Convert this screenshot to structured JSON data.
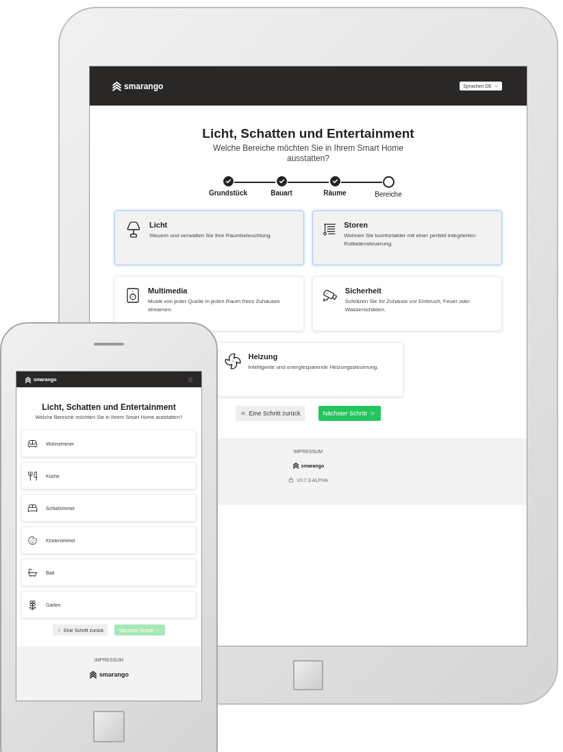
{
  "tablet": {
    "header": {
      "logo": "smarango",
      "language_select": "Sprachen DE"
    },
    "title": "Licht, Schatten und Entertainment",
    "subtitle": "Welche Bereiche möchten Sie in Ihrem Smart Home ausstatten?",
    "steps": [
      {
        "label": "Grundstück",
        "done": true
      },
      {
        "label": "Bauart",
        "done": true
      },
      {
        "label": "Räume",
        "done": true
      },
      {
        "label": "Bereiche",
        "done": false
      }
    ],
    "cards": [
      {
        "kind": "lamp",
        "title": "Licht",
        "text": "Steuern und verwalten Sie ihre Raumbeleuchtung.",
        "selected": true
      },
      {
        "kind": "blinds",
        "title": "Storen",
        "text": "Wohnen Sie komfortabler mit einer perfekt integrierten Rollladensteuerung.",
        "selected": true
      },
      {
        "kind": "speaker",
        "title": "Multimedia",
        "text": "Musik von jeder Quelle in jeden Raum Ihres Zuhauses streamen.",
        "selected": false
      },
      {
        "kind": "camera",
        "title": "Sicherheit",
        "text": "Schützen Sie ihr Zuhause vor Einbruch, Feuer oder Wasserschäden.",
        "selected": false
      },
      {
        "kind": "heating",
        "title": "Heizung",
        "text": "Intelligente und energiesparende Heizungssteuerung.",
        "selected": false
      }
    ],
    "back_button": "Eine Schritt zurück",
    "next_button": {
      "label": "Nächster Schritt",
      "disabled": false
    },
    "footer": {
      "link": "IMPRESSUM",
      "logo": "smarango",
      "version": "V0.7.3-ALPHA"
    }
  },
  "phone": {
    "header": {
      "logo": "smarango"
    },
    "title": "Licht, Schatten und Entertainment",
    "subtitle": "Welche Bereiche möchten Sie in Ihrem Smart Home ausstatten?",
    "rooms": [
      {
        "kind": "sofa",
        "label": "Wohnzimmer"
      },
      {
        "kind": "dining",
        "label": "Küche"
      },
      {
        "kind": "bed",
        "label": "Schlafzimmer"
      },
      {
        "kind": "kids",
        "label": "Kinderzimmer"
      },
      {
        "kind": "bath",
        "label": "Bad"
      },
      {
        "kind": "flower",
        "label": "Garten"
      }
    ],
    "back_button": "Eine Schritt zurück",
    "next_button": {
      "label": "Nächster Schritt",
      "disabled": true
    },
    "footer": {
      "link": "IMPRESSUM",
      "logo": "smarango"
    }
  }
}
